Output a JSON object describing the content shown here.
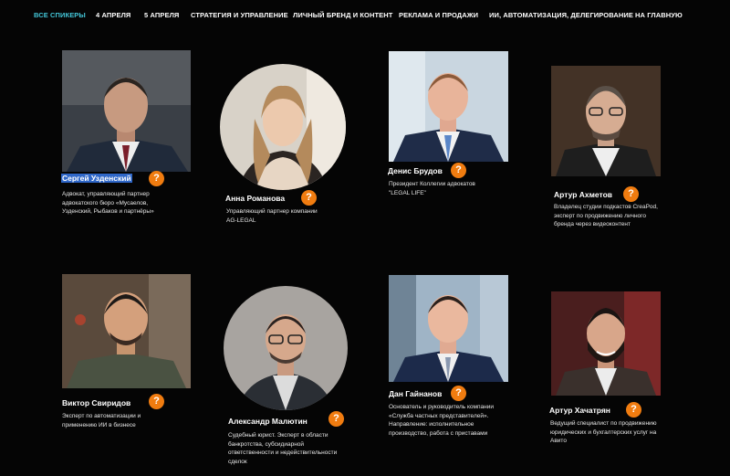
{
  "nav": {
    "items": [
      {
        "label": "ВСЕ СПИКЕРЫ",
        "active": true
      },
      {
        "label": "4 АПРЕЛЯ",
        "active": false
      },
      {
        "label": "5 АПРЕЛЯ",
        "active": false
      },
      {
        "label": "СТРАТЕГИЯ И УПРАВЛЕНИЕ",
        "active": false
      },
      {
        "label": "ЛИЧНЫЙ БРЕНД И КОНТЕНТ",
        "active": false
      },
      {
        "label": "РЕКЛАМА И ПРОДАЖИ",
        "active": false
      },
      {
        "label": "ИИ, АВТОМАТИЗАЦИЯ, ДЕЛЕГИРОВАНИЕ",
        "active": false
      },
      {
        "label": "НА ГЛАВНУЮ",
        "active": false
      }
    ]
  },
  "info_icon": "?",
  "colors": {
    "accent": "#43c6d8",
    "badge": "#f07c10",
    "selection": "#2f67c8"
  },
  "speakers": [
    {
      "name": "Сергей Узденский",
      "desc": [
        "Адвокат, управляющий партнер",
        "адвокатского бюро «Мусаелов,",
        "Узденский, Рыбаков и партнёры»"
      ],
      "photo": "square",
      "selected": true
    },
    {
      "name": "Анна Романова",
      "desc": [
        "Управляющий партнер компании",
        "AG-LEGAL"
      ],
      "photo": "circle",
      "selected": false
    },
    {
      "name": "Денис Брудов",
      "desc": [
        "Президент Коллегии адвокатов",
        "\"LEGAL LIFE\""
      ],
      "photo": "square",
      "selected": false
    },
    {
      "name": "Артур Ахметов",
      "desc": [
        "Владелец студии подкастов CreaPod,",
        "эксперт по продвижению личного",
        "бренда через видеоконтент"
      ],
      "photo": "square",
      "selected": false
    },
    {
      "name": "Виктор Свиридов",
      "desc": [
        "Эксперт по автоматизации и",
        "применению ИИ в бизнесе"
      ],
      "photo": "square",
      "selected": false
    },
    {
      "name": "Александр Малютин",
      "desc": [
        "Судебный юрист. Эксперт в области",
        "банкротства, субсидиарной",
        "ответственности и недействительности",
        "сделок"
      ],
      "photo": "circle",
      "selected": false
    },
    {
      "name": "Дан Гайнанов",
      "desc": [
        "Основатель и руководитель компании",
        "«Служба частных представителей».",
        "Направление: исполнительное",
        "производство, работа с приставами"
      ],
      "photo": "square",
      "selected": false
    },
    {
      "name": "Артур Хачатрян",
      "desc": [
        "Ведущий специалист по продвижению",
        "юридических и бухгалтерских услуг на",
        "Авито"
      ],
      "photo": "square",
      "selected": false
    }
  ]
}
